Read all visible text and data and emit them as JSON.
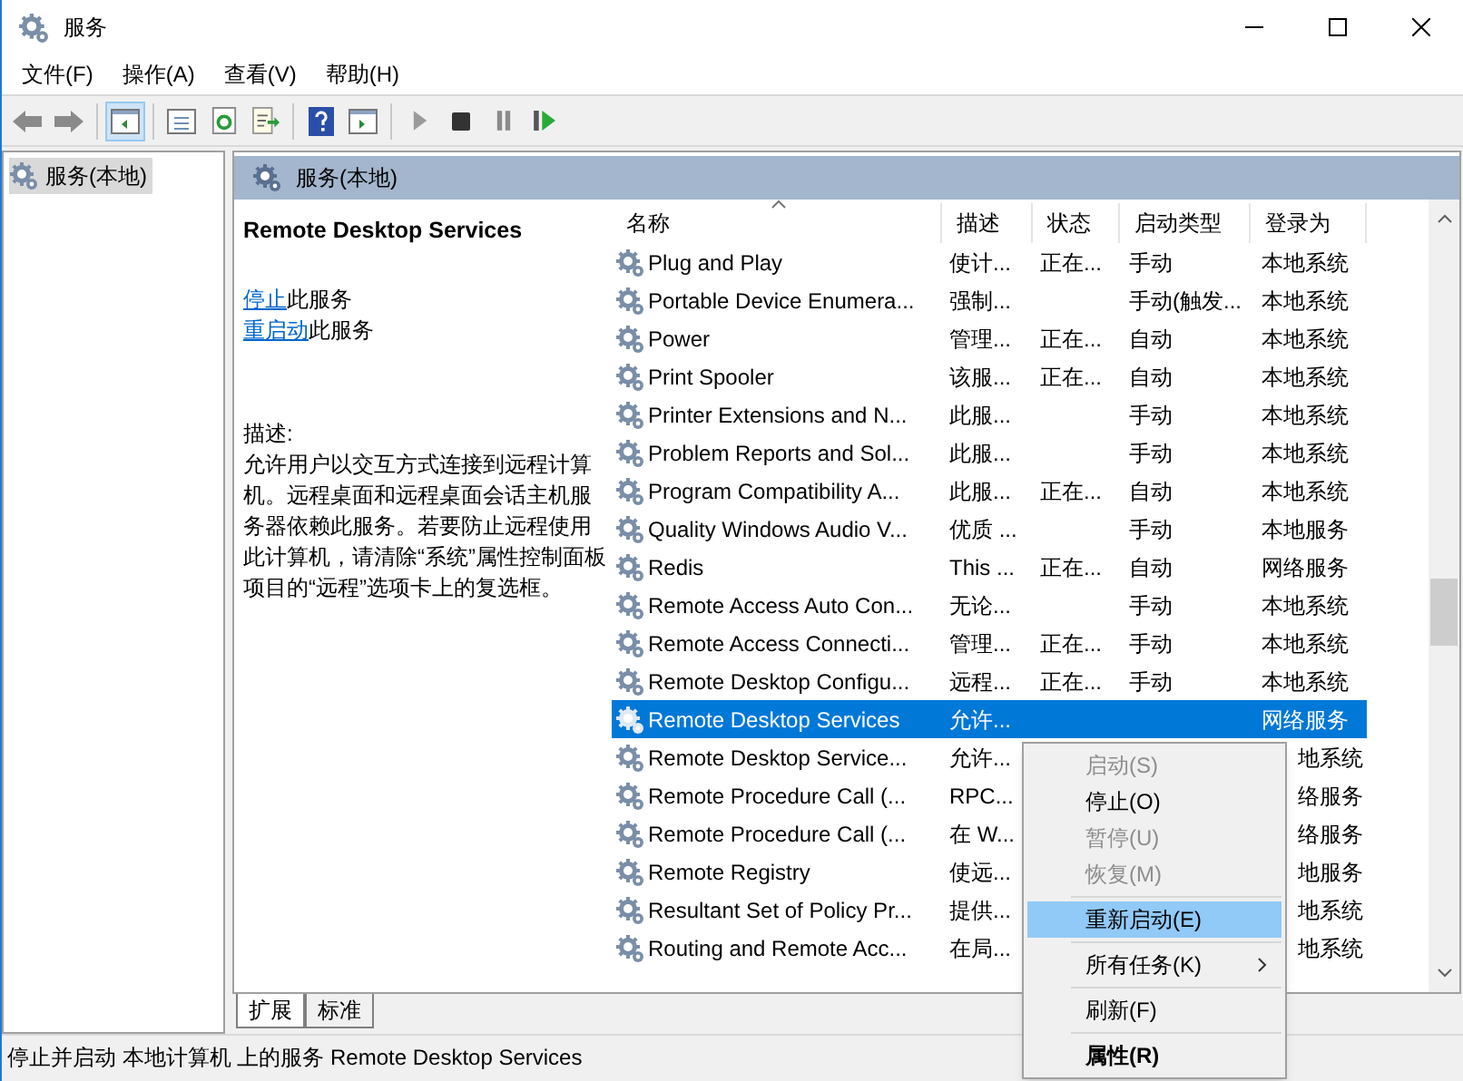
{
  "window": {
    "title": "服务"
  },
  "menu_bar": [
    "文件(F)",
    "操作(A)",
    "查看(V)",
    "帮助(H)"
  ],
  "toolbar": {
    "console_tree_shown": true
  },
  "tree": {
    "items": [
      {
        "label": "服务(本地)",
        "selected": true
      }
    ]
  },
  "header": {
    "title": "服务(本地)"
  },
  "details": {
    "service_name": "Remote Desktop Services",
    "actions": [
      {
        "link": "停止",
        "text": "此服务"
      },
      {
        "link": "重启动",
        "text": "此服务"
      }
    ],
    "description_label": "描述:",
    "description": "允许用户以交互方式连接到远程计算机。远程桌面和远程桌面会话主机服务器依赖此服务。若要防止远程使用此计算机，请清除“系统”属性控制面板项目的“远程”选项卡上的复选框。"
  },
  "table": {
    "columns": [
      {
        "label": "名称",
        "sorted": true
      },
      {
        "label": "描述",
        "sorted": false
      },
      {
        "label": "状态",
        "sorted": false
      },
      {
        "label": "启动类型",
        "sorted": false
      },
      {
        "label": "登录为",
        "sorted": false
      }
    ],
    "rows": [
      {
        "name": "Plug and Play",
        "description": "使计...",
        "status": "正在...",
        "startup": "手动",
        "logon": "本地系统",
        "selected": false,
        "covered": false
      },
      {
        "name": "Portable Device Enumera...",
        "description": "强制...",
        "startup": "手动(触发...",
        "logon": "本地系统",
        "selected": false,
        "covered": false
      },
      {
        "name": "Power",
        "description": "管理...",
        "status": "正在...",
        "startup": "自动",
        "logon": "本地系统",
        "selected": false,
        "covered": false
      },
      {
        "name": "Print Spooler",
        "description": "该服...",
        "status": "正在...",
        "startup": "自动",
        "logon": "本地系统",
        "selected": false,
        "covered": false
      },
      {
        "name": "Printer Extensions and N...",
        "description": "此服...",
        "startup": "手动",
        "logon": "本地系统",
        "selected": false,
        "covered": false
      },
      {
        "name": "Problem Reports and Sol...",
        "description": "此服...",
        "startup": "手动",
        "logon": "本地系统",
        "selected": false,
        "covered": false
      },
      {
        "name": "Program Compatibility A...",
        "description": "此服...",
        "status": "正在...",
        "startup": "自动",
        "logon": "本地系统",
        "selected": false,
        "covered": false
      },
      {
        "name": "Quality Windows Audio V...",
        "description": "优质 ...",
        "startup": "手动",
        "logon": "本地服务",
        "selected": false,
        "covered": false
      },
      {
        "name": "Redis",
        "description": "This ...",
        "status": "正在...",
        "startup": "自动",
        "logon": "网络服务",
        "selected": false,
        "covered": false
      },
      {
        "name": "Remote Access Auto Con...",
        "description": "无论...",
        "startup": "手动",
        "logon": "本地系统",
        "selected": false,
        "covered": false
      },
      {
        "name": "Remote Access Connecti...",
        "description": "管理...",
        "status": "正在...",
        "startup": "手动",
        "logon": "本地系统",
        "selected": false,
        "covered": false
      },
      {
        "name": "Remote Desktop Configu...",
        "description": "远程...",
        "status": "正在...",
        "startup": "手动",
        "logon": "本地系统",
        "selected": false,
        "covered": false
      },
      {
        "name": "Remote Desktop Services",
        "description": "允许...",
        "logon": "网络服务",
        "selected": true,
        "covered": false
      },
      {
        "name": "Remote Desktop Service...",
        "description": "允许...",
        "logon": "地系统",
        "selected": false,
        "covered": true
      },
      {
        "name": "Remote Procedure Call (...",
        "description": "RPC...",
        "logon": "络服务",
        "selected": false,
        "covered": true
      },
      {
        "name": "Remote Procedure Call (...",
        "description": "在 W...",
        "logon": "络服务",
        "selected": false,
        "covered": true
      },
      {
        "name": "Remote Registry",
        "description": "使远...",
        "logon": "地服务",
        "selected": false,
        "covered": true
      },
      {
        "name": "Resultant Set of Policy Pr...",
        "description": "提供...",
        "logon": "地系统",
        "selected": false,
        "covered": true
      },
      {
        "name": "Routing and Remote Acc...",
        "description": "在局...",
        "logon": "地系统",
        "selected": false,
        "covered": true
      }
    ]
  },
  "view_tabs": [
    {
      "label": "扩展",
      "selected": true
    },
    {
      "label": "标准",
      "selected": false
    }
  ],
  "context_menu": {
    "items": [
      {
        "kind": "item",
        "label": "启动(S)",
        "disabled": true,
        "selected": false
      },
      {
        "kind": "item",
        "label": "停止(O)",
        "disabled": false,
        "selected": false
      },
      {
        "kind": "item",
        "label": "暂停(U)",
        "disabled": true,
        "selected": false
      },
      {
        "kind": "item",
        "label": "恢复(M)",
        "disabled": true,
        "selected": false
      },
      {
        "kind": "separator"
      },
      {
        "kind": "item",
        "label": "重新启动(E)",
        "disabled": false,
        "selected": true
      },
      {
        "kind": "separator"
      },
      {
        "kind": "submenu",
        "label": "所有任务(K)",
        "disabled": false,
        "selected": false
      },
      {
        "kind": "separator"
      },
      {
        "kind": "item",
        "label": "刷新(F)",
        "disabled": false,
        "selected": false
      },
      {
        "kind": "separator"
      },
      {
        "kind": "default",
        "label": "属性(R)",
        "disabled": false,
        "selected": false
      }
    ]
  },
  "status_bar": "停止并启动 本地计算机 上的服务 Remote Desktop Services"
}
